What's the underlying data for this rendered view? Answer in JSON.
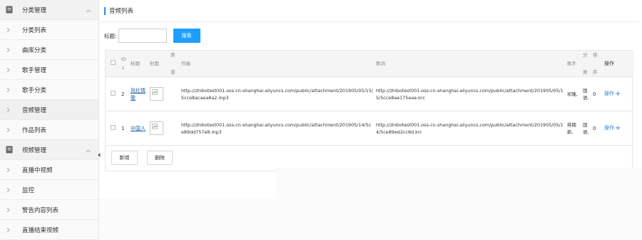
{
  "sidebar": {
    "groups": [
      {
        "label": "分类管理",
        "items": [
          {
            "label": "分类列表"
          },
          {
            "label": "曲库分类"
          },
          {
            "label": "歌手管理"
          },
          {
            "label": "歌手分类"
          },
          {
            "label": "音频管理"
          },
          {
            "label": "作品列表"
          }
        ]
      },
      {
        "label": "视频管理",
        "items": [
          {
            "label": "直播中视频"
          },
          {
            "label": "监控"
          },
          {
            "label": "警告内容列表"
          },
          {
            "label": "直播结束视频"
          }
        ]
      }
    ]
  },
  "page": {
    "title": "音频列表"
  },
  "search": {
    "label": "标题:",
    "value": "",
    "placeholder": "",
    "button": "搜索"
  },
  "table": {
    "headers": {
      "id_line1": "ID",
      "id_line2": "↓",
      "title": "标题",
      "cover": "封面",
      "origin_line1": "原",
      "origin_line2": "谱",
      "composer": "作曲",
      "lyrics": "歌词",
      "singer": "歌手",
      "cat_line1": "分",
      "cat_line2": "类",
      "sort_line1": "排",
      "sort_line2": "序",
      "op": "操作"
    },
    "rows": [
      {
        "id": "2",
        "title": "凤红情歌",
        "composer": "http://zhibotest001.oss-cn-shanghai.aliyuncs.com/public/attachment/201905/05/15/5cce8acaea8a2.mp3",
        "lyrics": "http://zhibotest001.oss-cn-shanghai.aliyuncs.com/public/attachment/201905/05/15/5cce8ae175eae.krc",
        "singer": "祁隆,",
        "category": "国语,",
        "sort": "0",
        "op": "操作",
        "plus": "+"
      },
      {
        "id": "1",
        "title": "中国人",
        "composer": "http://zhibotest001.oss-cn-shanghai.aliyuncs.com/public/attachment/201905/14/5ce89dd757e8.mp3",
        "lyrics": "http://zhibotest001.oss-cn-shanghai.aliyuncs.com/public/attachment/201905/05/14/5ce89ed2cc6d.krc",
        "singer": "蒋楠新,",
        "category": "国语,",
        "sort": "0",
        "op": "操作",
        "plus": "+"
      }
    ]
  },
  "actions": {
    "add": "新增",
    "delete": "删除"
  },
  "colors": {
    "accent": "#1e9fff",
    "title_bar": "#2b8ae2",
    "link": "#2b7bd6"
  }
}
